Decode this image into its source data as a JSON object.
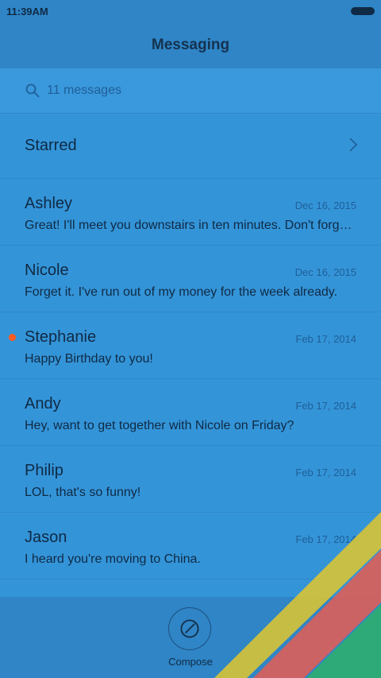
{
  "status_bar": {
    "time": "11:39AM"
  },
  "header": {
    "title": "Messaging"
  },
  "search": {
    "placeholder": "11 messages"
  },
  "starred": {
    "label": "Starred"
  },
  "conversations": [
    {
      "name": "Ashley",
      "date": "Dec 16, 2015",
      "preview": "Great! I'll meet you downstairs in ten minutes. Don't forget your umbrella.",
      "unread": false
    },
    {
      "name": "Nicole",
      "date": "Dec 16, 2015",
      "preview": "Forget it. I've run out of my money for the week already.",
      "unread": false
    },
    {
      "name": "Stephanie",
      "date": "Feb 17, 2014",
      "preview": "Happy Birthday to you!",
      "unread": true
    },
    {
      "name": "Andy",
      "date": "Feb 17, 2014",
      "preview": "Hey, want to get together with Nicole on Friday?",
      "unread": false
    },
    {
      "name": "Philip",
      "date": "Feb 17, 2014",
      "preview": "LOL, that's so funny!",
      "unread": false
    },
    {
      "name": "Jason",
      "date": "Feb 17, 2014",
      "preview": "I heard you're moving to China.",
      "unread": false
    }
  ],
  "bottom_bar": {
    "compose_label": "Compose"
  },
  "icons": {
    "search": "search-icon",
    "chevron": "chevron-right-icon",
    "compose": "compose-icon",
    "battery": "battery-icon",
    "unread": "unread-dot"
  },
  "colors": {
    "background": "#3494d8",
    "bars": "#2f85c6",
    "unread_dot": "#ff5a1f",
    "stripe_yellow": "#d4c23a",
    "stripe_red": "#d9605a",
    "stripe_green": "#2fae72"
  }
}
